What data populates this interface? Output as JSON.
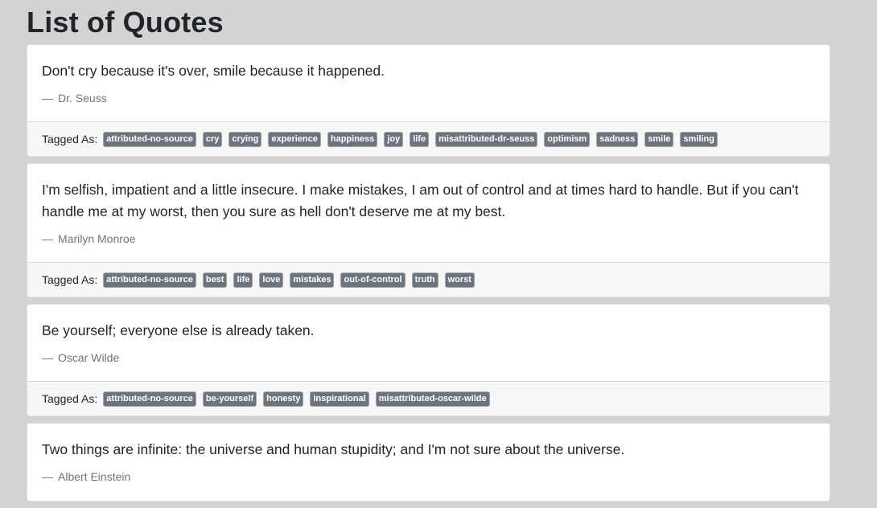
{
  "page": {
    "title": "List of Quotes",
    "tagged_label": "Tagged As:",
    "dash": "—"
  },
  "quotes": [
    {
      "text": "Don't cry because it's over, smile because it happened.",
      "author": "Dr. Seuss",
      "tags": [
        "attributed-no-source",
        "cry",
        "crying",
        "experience",
        "happiness",
        "joy",
        "life",
        "misattributed-dr-seuss",
        "optimism",
        "sadness",
        "smile",
        "smiling"
      ]
    },
    {
      "text": "I'm selfish, impatient and a little insecure. I make mistakes, I am out of control and at times hard to handle. But if you can't handle me at my worst, then you sure as hell don't deserve me at my best.",
      "author": "Marilyn Monroe",
      "tags": [
        "attributed-no-source",
        "best",
        "life",
        "love",
        "mistakes",
        "out-of-control",
        "truth",
        "worst"
      ]
    },
    {
      "text": "Be yourself; everyone else is already taken.",
      "author": "Oscar Wilde",
      "tags": [
        "attributed-no-source",
        "be-yourself",
        "honesty",
        "inspirational",
        "misattributed-oscar-wilde"
      ]
    },
    {
      "text": "Two things are infinite: the universe and human stupidity; and I'm not sure about the universe.",
      "author": "Albert Einstein",
      "tags": []
    }
  ],
  "colors": {
    "background": "#d3d3d3",
    "card": "#ffffff",
    "footer": "#f7f7f7",
    "tag": "#6c757d",
    "author": "#6c757d",
    "text": "#212529"
  }
}
